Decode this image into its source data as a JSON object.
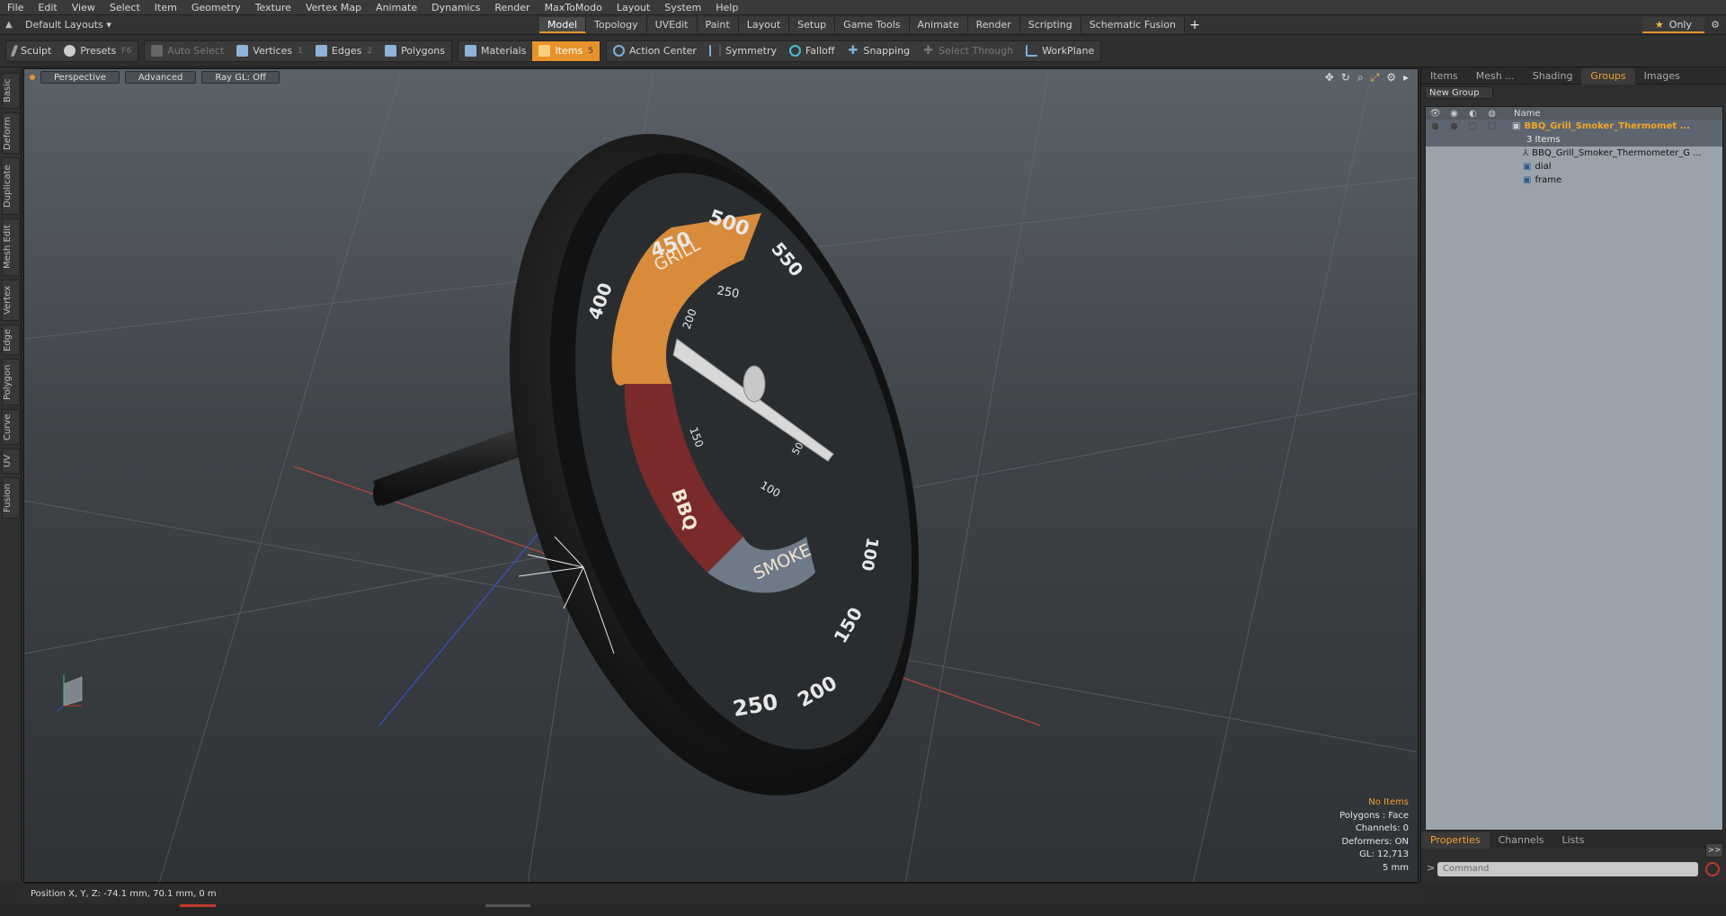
{
  "menu": [
    "File",
    "Edit",
    "View",
    "Select",
    "Item",
    "Geometry",
    "Texture",
    "Vertex Map",
    "Animate",
    "Dynamics",
    "Render",
    "MaxToModo",
    "Layout",
    "System",
    "Help"
  ],
  "layout_selector": "Default Layouts",
  "layout_tabs": [
    "Model",
    "Topology",
    "UVEdit",
    "Paint",
    "Layout",
    "Setup",
    "Game Tools",
    "Animate",
    "Render",
    "Scripting",
    "Schematic Fusion"
  ],
  "active_layout_tab": "Model",
  "only_label": "Only",
  "toolbar": {
    "sculpt": "Sculpt",
    "presets": "Presets",
    "presets_key": "F6",
    "auto_select": "Auto Select",
    "vertices": "Vertices",
    "vertices_key": "1",
    "edges": "Edges",
    "edges_key": "2",
    "polygons": "Polygons",
    "materials": "Materials",
    "items": "Items",
    "items_key": "5",
    "action_center": "Action Center",
    "symmetry": "Symmetry",
    "falloff": "Falloff",
    "snapping": "Snapping",
    "select_through": "Select Through",
    "workplane": "WorkPlane"
  },
  "left_tabs": [
    "Basic",
    "Deform",
    "Duplicate",
    "Mesh Edit",
    "Vertex",
    "Edge",
    "Polygon",
    "Curve",
    "UV",
    "Fusion"
  ],
  "viewport": {
    "view": "Perspective",
    "shading": "Advanced",
    "raygl": "Ray GL: Off"
  },
  "gauge": {
    "outer_numbers": [
      "450",
      "500",
      "550",
      "400",
      "100",
      "150",
      "200",
      "250"
    ],
    "inner_numbers": [
      "250",
      "200",
      "150",
      "100",
      "50"
    ],
    "zone_labels": {
      "grill": "GRILL",
      "bbq": "BBQ",
      "smoke": "SMOKE"
    },
    "colors": {
      "grill": "#d78b3b",
      "bbq": "#7a2a2a",
      "smoke": "#6e7a88",
      "face": "#2a2d30"
    }
  },
  "stats": {
    "items": "No Items",
    "polygons": "Polygons : Face",
    "channels": "Channels: 0",
    "deformers": "Deformers: ON",
    "gl": "GL: 12,713",
    "unit": "5 mm"
  },
  "status": {
    "position": "Position X, Y, Z:  -74.1 mm, 70.1 mm, 0 m"
  },
  "right_panel": {
    "tabs": [
      "Items",
      "Mesh ...",
      "Shading",
      "Groups",
      "Images"
    ],
    "active_tab": "Groups",
    "new_group": "New Group",
    "name_header": "Name",
    "group_name": "BBQ_Grill_Smoker_Thermomet ...",
    "group_count": "3 Items",
    "children": [
      "BBQ_Grill_Smoker_Thermometer_G ...",
      "dial",
      "frame"
    ],
    "bottom_tabs": [
      "Properties",
      "Channels",
      "Lists"
    ],
    "active_bottom_tab": "Properties",
    "command_placeholder": "Command"
  }
}
